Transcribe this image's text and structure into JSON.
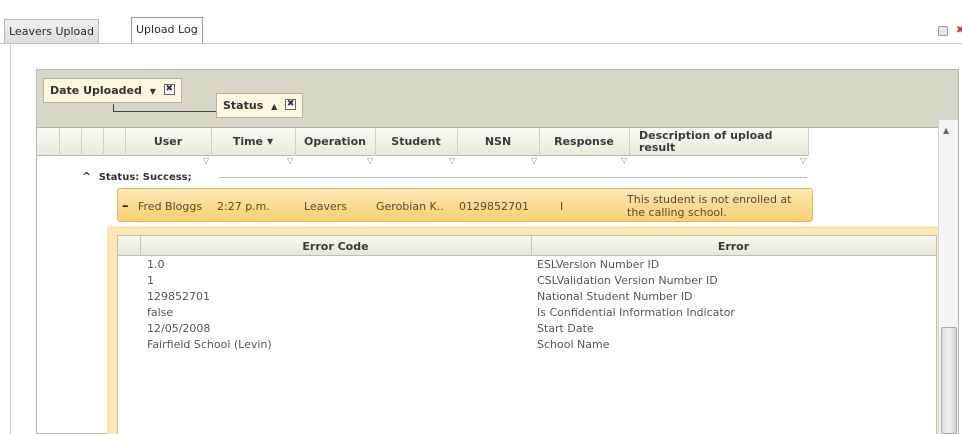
{
  "tabs": [
    {
      "label": "Leavers Upload",
      "active": false
    },
    {
      "label": "Upload Log",
      "active": true
    }
  ],
  "group_chips": [
    {
      "label": "Date Uploaded",
      "sort": "▼",
      "remove": "✖"
    },
    {
      "label": "Status",
      "sort": "▲",
      "remove": "✖"
    }
  ],
  "columns": [
    "User",
    "Time",
    "Operation",
    "Student",
    "NSN",
    "Response",
    "Description of upload result"
  ],
  "time_sort_icon": "▼",
  "filter_icon": "funnel-icon",
  "status_group": {
    "caret": "^",
    "label": "Status: Success;"
  },
  "row": {
    "expander": "–",
    "user": "Fred Bloggs",
    "time": "2:27 p.m.",
    "operation": "Leavers",
    "student": "Gerobian K..",
    "nsn": "0129852701",
    "response": "I",
    "description": "This student is not enrolled at the calling school."
  },
  "detail": {
    "columns": [
      "Error Code",
      "Error"
    ],
    "rows": [
      [
        "1.0",
        "ESLVersion Number ID"
      ],
      [
        "1",
        "CSLValidation Version Number ID"
      ],
      [
        "129852701",
        "National Student Number ID"
      ],
      [
        "false",
        "Is Confidential Information Indicator"
      ],
      [
        "12/05/2008",
        "Start Date"
      ],
      [
        "Fairfield School (Levin)",
        "School Name"
      ]
    ]
  },
  "colors": {
    "row_highlight": "#f6cf6f",
    "group_bar": "#d6d6c9",
    "detail_bg": "#fbe7b3"
  }
}
